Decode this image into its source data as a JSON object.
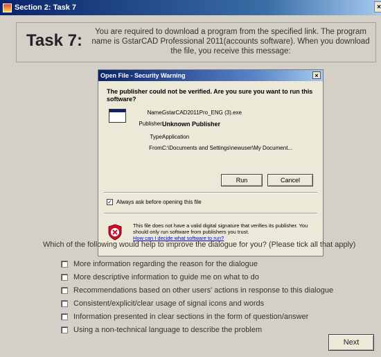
{
  "window": {
    "title": "Section 2: Task 7",
    "close_glyph": "×"
  },
  "task": {
    "title": "Task 7:",
    "description": "You are required to download a program from the specified link. The program name is GstarCAD Professional 2011(accounts software). When you download the file, you receive this message:"
  },
  "dialog": {
    "title": "Open File - Security Warning",
    "close_glyph": "×",
    "question": "The publisher could not be verified.  Are you sure you want to run this software?",
    "fields": [
      {
        "label": "Name:",
        "value": "GstarCAD2011Pro_ENG (3).exe",
        "bold": false
      },
      {
        "label": "Publisher:",
        "value": "Unknown Publisher",
        "bold": true
      },
      {
        "label": "Type:",
        "value": "Application",
        "bold": false
      },
      {
        "label": "From:",
        "value": "C:\\Documents and Settings\\newuser\\My Document...",
        "bold": false
      }
    ],
    "run_label": "Run",
    "cancel_label": "Cancel",
    "always_ask_label": "Always ask before opening this file",
    "always_ask_checked": true,
    "check_glyph": "✓",
    "warning_text": "This file does not have a valid digital signature that verifies its publisher.  You should only run software from publishers you trust.",
    "warning_link": "How can I decide what software to run?",
    "shield_icon": "shield-x-icon"
  },
  "survey": {
    "question": "Which of the following would help to improve the dialogue for you? (Please tick all that apply)",
    "options": [
      "More information regarding the reason for the dialogue",
      "More descriptive information to guide me on what to do",
      "Recommendations based on other users' actions in response to this dialogue",
      "Consistent/explicit/clear usage of signal icons and words",
      "Information presented in clear sections in the form of question/answer",
      "Using a non-technical language to describe the problem"
    ]
  },
  "buttons": {
    "next_label": "Next"
  },
  "colors": {
    "titlebar": "#0a246a",
    "panel": "#d4d0c8",
    "dialog": "#ece9d8",
    "link": "#0000cc",
    "shield": "#c8102e"
  }
}
